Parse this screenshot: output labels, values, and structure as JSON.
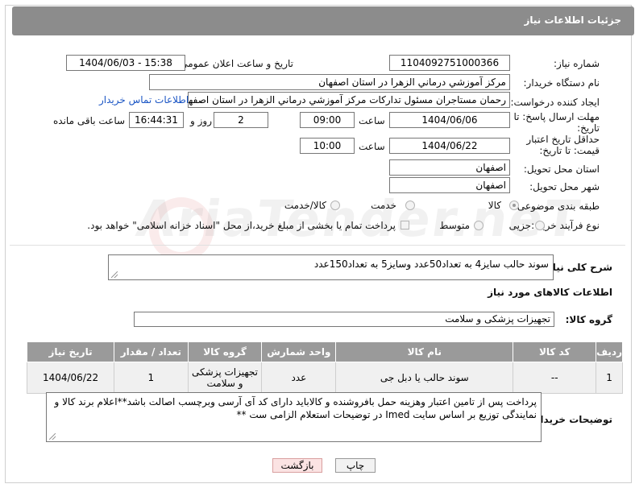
{
  "header": {
    "title": "جزئیات اطلاعات نیاز"
  },
  "labels": {
    "need_number": "شماره نیاز:",
    "announce_datetime": "تاریخ و ساعت اعلان عمومی:",
    "buyer_org": "نام دستگاه خریدار:",
    "requester": "ایجاد کننده درخواست:",
    "reply_deadline": "مهلت ارسال پاسخ: تا تاریخ:",
    "time": "ساعت",
    "day_and": "روز و",
    "remaining": "ساعت باقی مانده",
    "price_validity": "حداقل تاریخ اعتبار قیمت: تا تاریخ:",
    "delivery_province": "استان محل تحویل:",
    "delivery_city": "شهر محل تحویل:",
    "category": "طبقه بندی موضوعی:",
    "purchase_process": "نوع فرآیند خرید :",
    "general_desc": "شرح کلی نیاز:",
    "goods_info": "اطلاعات کالاهای مورد نیاز",
    "goods_group": "گروه کالا:",
    "buyer_notes": "توضیحات خریدار:"
  },
  "values": {
    "need_number": "1104092751000366",
    "announce_datetime": "1404/06/03 - 15:38",
    "buyer_org": "مرکز آموزشي درماني الزهرا در استان اصفهان",
    "requester": "رحمان مستاجران مسئول تداركات مرکز آموزشي درماني الزهرا در استان اصفهان",
    "contact_link": "اطلاعات تماس خریدار",
    "reply_date": "1404/06/06",
    "reply_time": "09:00",
    "reply_days": "2",
    "reply_remaining": "16:44:31",
    "price_date": "1404/06/22",
    "price_time": "10:00",
    "province": "اصفهان",
    "city": "اصفهان",
    "general_desc": "سوند حالب سایز4 به تعداد50عدد وسایز5 به تعداد150عدد",
    "goods_group": "تجهیزات پزشکی و سلامت",
    "buyer_notes": "پرداخت پس از تامین اعتبار وهزینه حمل بافروشنده و کالاباید دارای کد آی آرسی وبرچسب اصالت باشد**اعلام برند کالا و نمایندگی توزیع بر اساس سایت Imed در توضیحات استعلام الزامی ست **"
  },
  "category_options": [
    {
      "label": "کالا",
      "selected": true
    },
    {
      "label": "خدمت",
      "selected": false
    },
    {
      "label": "کالا/خدمت",
      "selected": false
    }
  ],
  "process_options": [
    {
      "label": "جزیی",
      "selected": false
    },
    {
      "label": "متوسط",
      "selected": false
    }
  ],
  "process_note": "پرداخت تمام یا بخشی از مبلغ خرید،از محل \"اسناد خزانه اسلامی\" خواهد بود.",
  "table": {
    "headers": [
      "ردیف",
      "کد کالا",
      "نام کالا",
      "واحد شمارش",
      "گروه کالا",
      "تعداد / مقدار",
      "تاریخ نیاز"
    ],
    "rows": [
      [
        "1",
        "--",
        "سوند حالب یا دبل جی",
        "عدد",
        "تجهیزات پزشکی و سلامت",
        "1",
        "1404/06/22"
      ]
    ]
  },
  "buttons": {
    "print": "چاپ",
    "back": "بازگشت"
  },
  "watermark": "AriaTender.neT"
}
